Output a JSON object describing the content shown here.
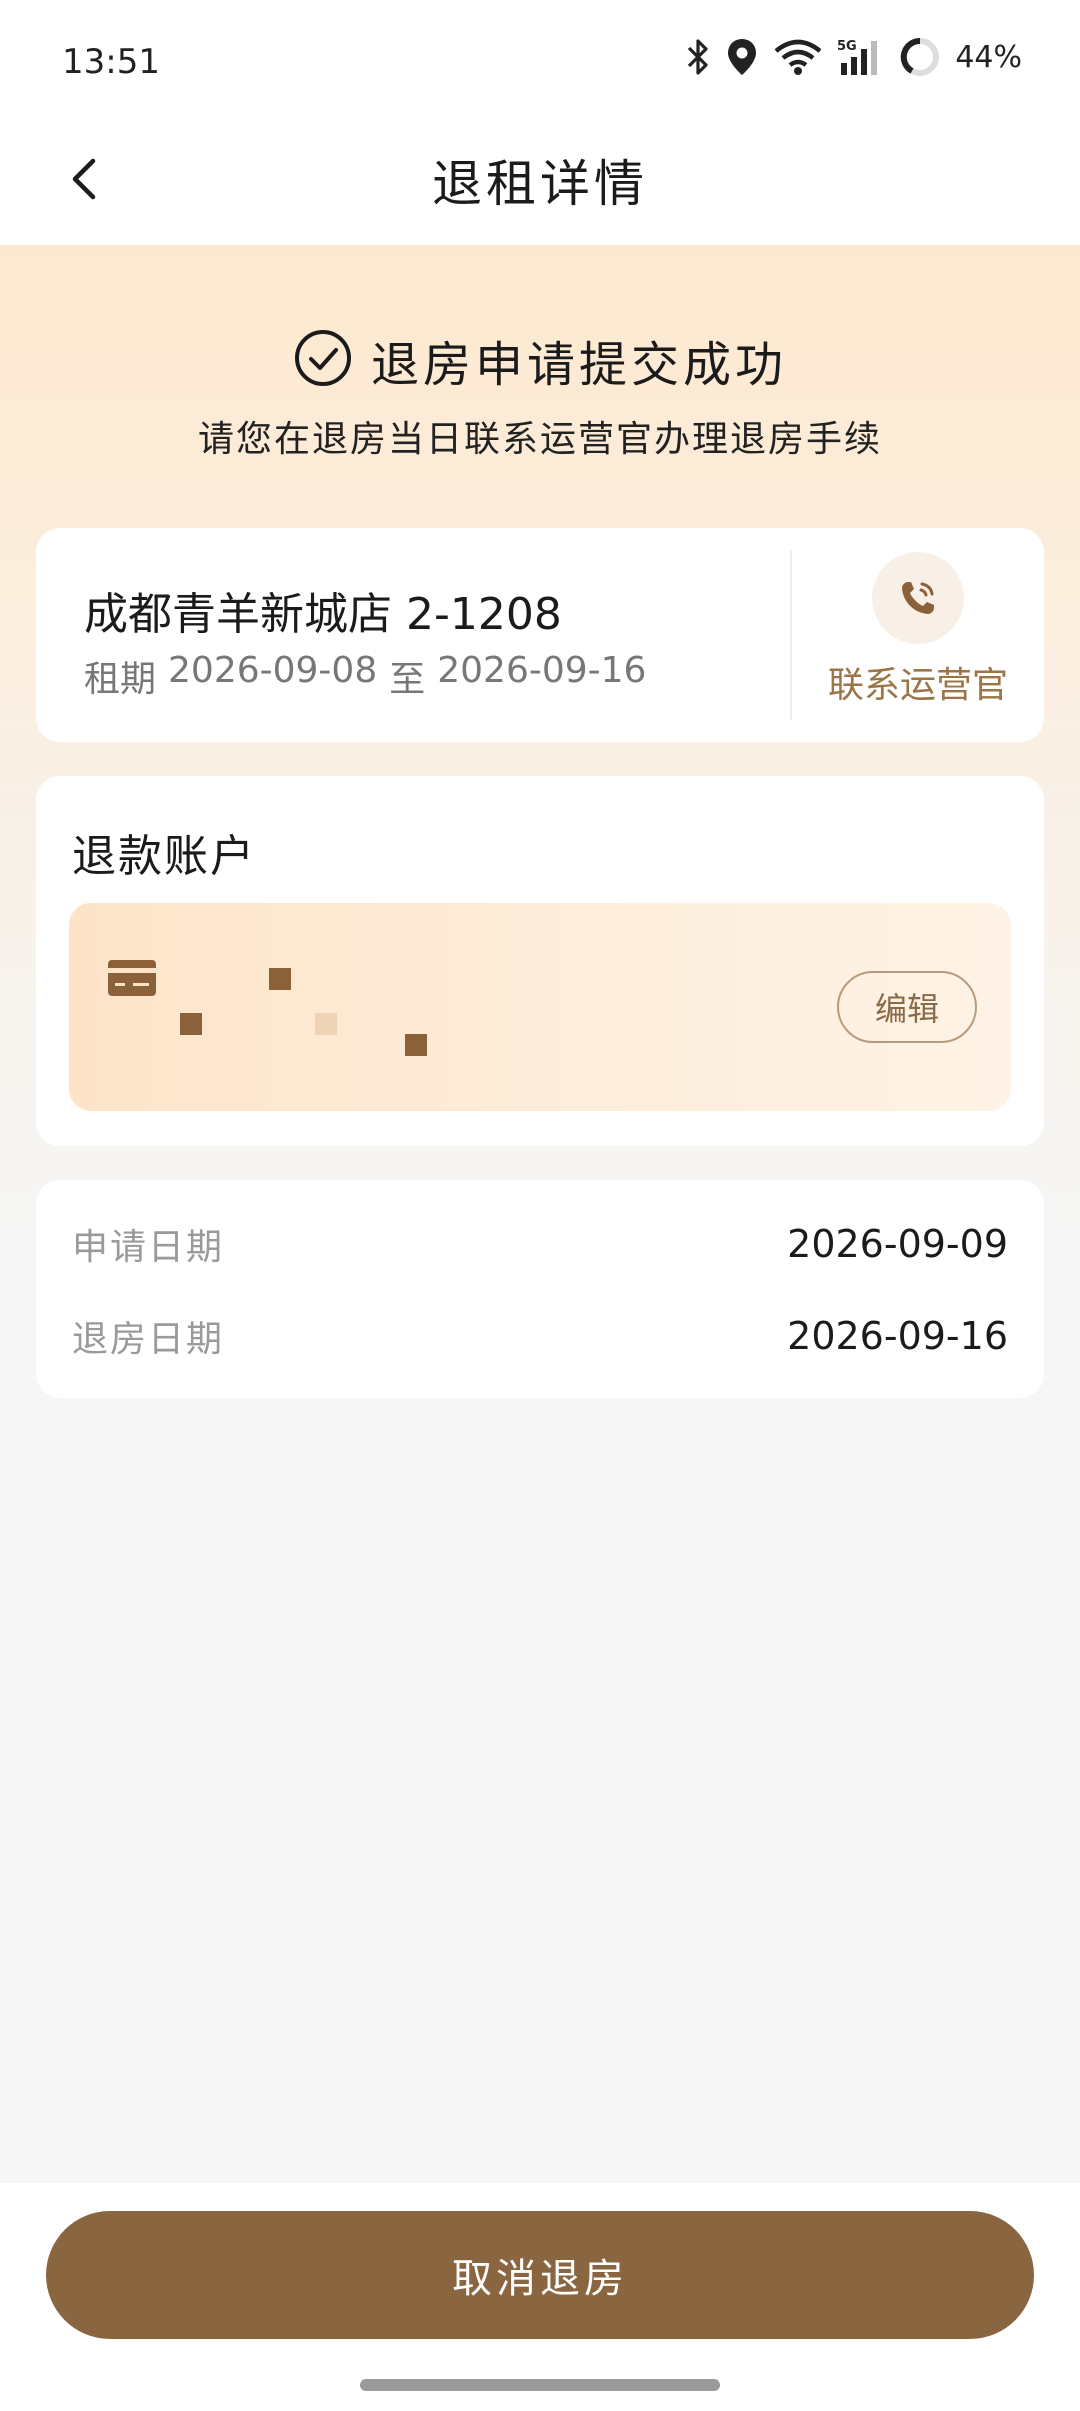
{
  "status_bar": {
    "time": "13:51",
    "battery": "44%",
    "network": "5G",
    "icons": [
      "bluetooth-icon",
      "location-icon",
      "wifi-icon",
      "signal-icon",
      "battery-icon"
    ]
  },
  "nav": {
    "title": "退租详情",
    "back_icon": "chevron-left-icon"
  },
  "hero": {
    "success_title": "退房申请提交成功",
    "success_icon": "check-circle-icon",
    "subtitle": "请您在退房当日联系运营官办理退房手续"
  },
  "room": {
    "name": "成都青羊新城店 2-1208",
    "period_label": "租期",
    "period_start": "2026-09-08",
    "period_sep": "至",
    "period_end": "2026-09-16",
    "contact_label": "联系运营官",
    "contact_icon": "phone-icon"
  },
  "refund": {
    "title": "退款账户",
    "card_icon": "credit-card-icon",
    "edit_label": "编辑"
  },
  "dates": [
    {
      "label": "申请日期",
      "value": "2026-09-09"
    },
    {
      "label": "退房日期",
      "value": "2026-09-16"
    }
  ],
  "footer": {
    "cancel_label": "取消退房"
  },
  "colors": {
    "accent": "#8a6640",
    "accent_text": "#9b7447",
    "hero_top": "#fde8cf",
    "page_bg": "#f6f6f6"
  }
}
